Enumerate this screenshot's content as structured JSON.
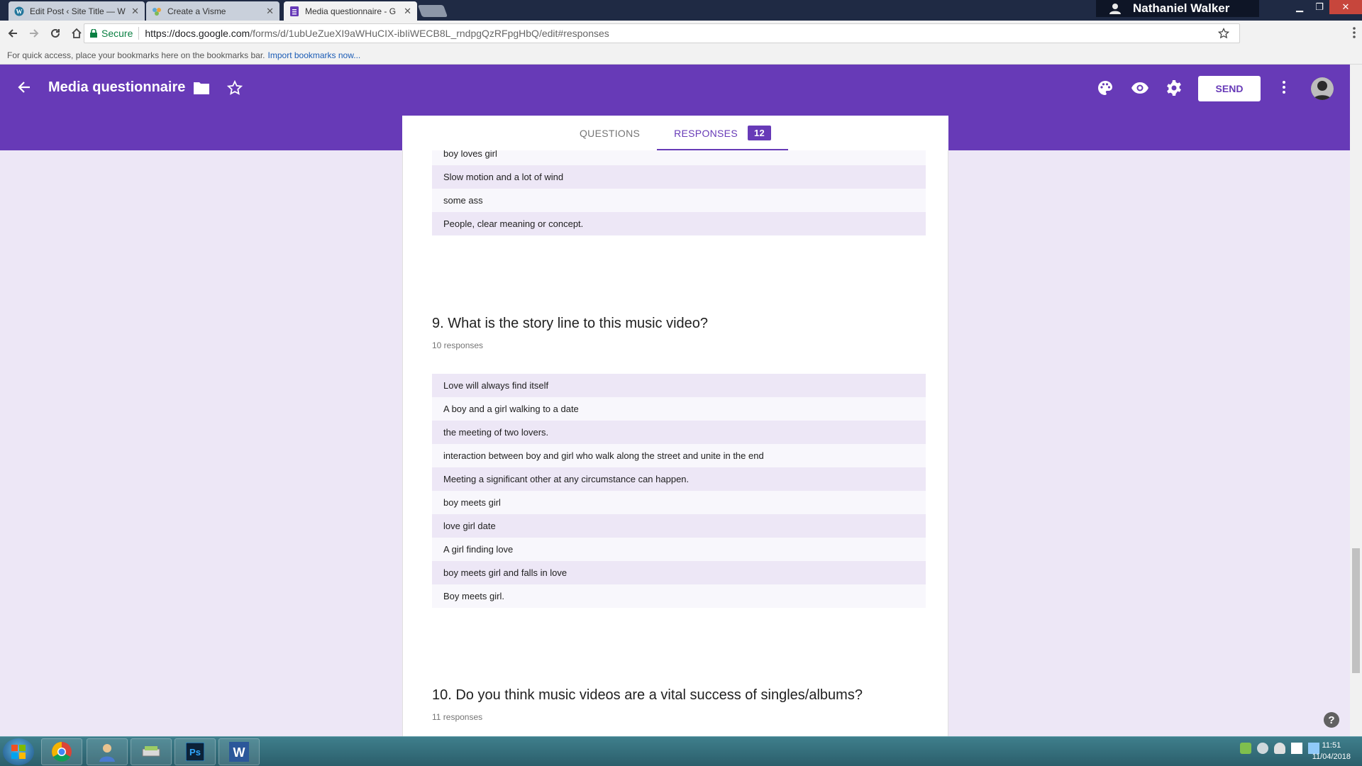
{
  "browser": {
    "tabs": [
      {
        "title": "Edit Post ‹ Site Title — W",
        "close": "✕"
      },
      {
        "title": "Create a Visme",
        "close": "✕"
      },
      {
        "title": "Media questionnaire - G",
        "close": "✕"
      }
    ],
    "profile_name": "Nathaniel Walker",
    "secure_label": "Secure",
    "url_host": "https://docs.google.com",
    "url_path": "/forms/d/1ubUeZueXI9aWHuCIX-ibIiWECB8L_rndpgQzRFpgHbQ/edit#responses",
    "bookmarks_text": "For quick access, place your bookmarks here on the bookmarks bar.",
    "bookmarks_link": "Import bookmarks now..."
  },
  "forms": {
    "title": "Media questionnaire",
    "send_label": "SEND",
    "tabs": {
      "questions": "QUESTIONS",
      "responses": "RESPONSES",
      "responses_count": "12"
    },
    "accent": "#673ab7"
  },
  "content": {
    "prev_responses": [
      "boy loves girl",
      "Slow motion and a lot of wind",
      "some ass",
      "People, clear meaning or concept."
    ],
    "q9": {
      "title": "9. What is the story line to this music video?",
      "count": "10 responses",
      "responses": [
        "Love will always find itself",
        "A boy and a girl walking to a date",
        "the meeting of two lovers.",
        "interaction between boy and girl who walk along the street and unite in the end",
        "Meeting a significant other at any circumstance can happen.",
        "boy meets girl",
        "love girl date",
        "A girl finding love",
        "boy meets girl and falls in love",
        "Boy meets girl."
      ]
    },
    "q10": {
      "title": "10. Do you think music videos are a vital success of singles/albums?",
      "count": "11 responses"
    }
  },
  "taskbar": {
    "time": "11:51",
    "date": "11/04/2018"
  }
}
